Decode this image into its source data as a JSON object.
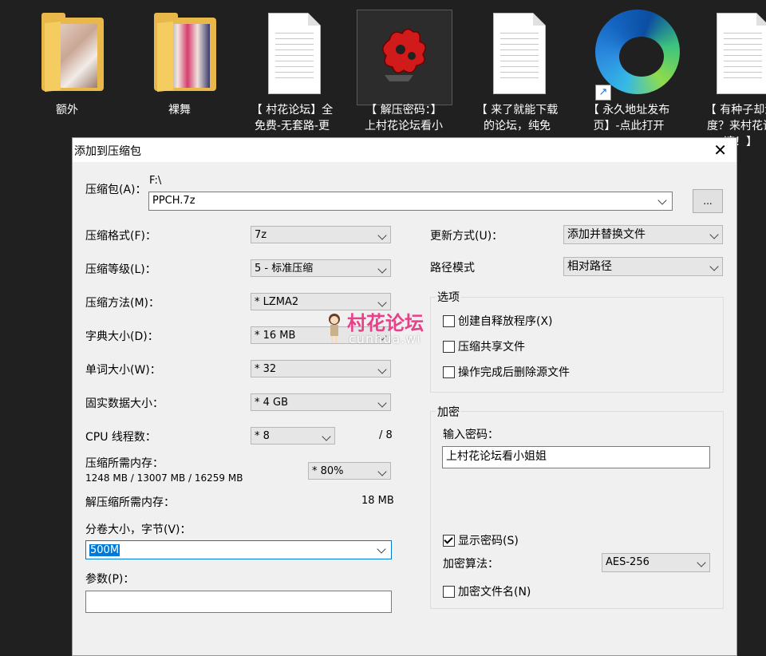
{
  "desktop": {
    "icons": [
      {
        "label": "额外",
        "type": "folder"
      },
      {
        "label": "裸舞",
        "type": "folder"
      },
      {
        "label": "【 村花论坛】全\n免费-无套路-更",
        "type": "document"
      },
      {
        "label": "【 解压密码：】\n上村花论坛看小",
        "type": "puzzle"
      },
      {
        "label": "【 来了就能下载\n的论坛，纯免",
        "type": "document"
      },
      {
        "label": "【 永久地址发布\n页】-点此打开",
        "type": "edge-shortcut"
      },
      {
        "label": "【 有种子却没\n度？来村花论\n速！】",
        "type": "document"
      }
    ]
  },
  "dialog": {
    "title": "添加到压缩包",
    "close_glyph": "✕",
    "archive_label": "压缩包(A)：",
    "archive_path": "F:\\",
    "archive_name": "PPCH.7z",
    "browse_label": "...",
    "format_label": "压缩格式(F)：",
    "format_value": "7z",
    "level_label": "压缩等级(L)：",
    "level_value": "5 - 标准压缩",
    "method_label": "压缩方法(M)：",
    "method_value": "* LZMA2",
    "dict_label": "字典大小(D)：",
    "dict_value": "* 16 MB",
    "word_label": "单词大小(W)：",
    "word_value": "* 32",
    "solid_label": "固实数据大小：",
    "solid_value": "* 4 GB",
    "cpu_label": "CPU 线程数：",
    "cpu_value": "* 8",
    "cpu_total": "/ 8",
    "mem_label": "压缩所需内存：",
    "mem_detail": "1248 MB / 13007 MB / 16259 MB",
    "mem_percent": "* 80%",
    "decomp_label": "解压缩所需内存：",
    "decomp_value": "18 MB",
    "volume_label": "分卷大小，字节(V)：",
    "volume_value": "500M",
    "params_label": "参数(P)：",
    "params_value": "",
    "update_label": "更新方式(U)：",
    "update_value": "添加并替换文件",
    "path_label": "路径模式",
    "path_value": "相对路径",
    "options": {
      "title": "选项",
      "items": [
        {
          "label": "创建自释放程序(X)",
          "checked": false
        },
        {
          "label": "压缩共享文件",
          "checked": false
        },
        {
          "label": "操作完成后删除源文件",
          "checked": false
        }
      ]
    },
    "encryption": {
      "title": "加密",
      "password_label": "输入密码：",
      "password_value": "上村花论坛看小姐姐",
      "show_password_label": "显示密码(S)",
      "show_password_checked": true,
      "method_label": "加密算法：",
      "method_value": "AES-256",
      "encrypt_names_label": "加密文件名(N)",
      "encrypt_names_checked": false
    }
  },
  "watermark": {
    "title": "村花论坛",
    "subtitle": "cunhua.wi"
  }
}
